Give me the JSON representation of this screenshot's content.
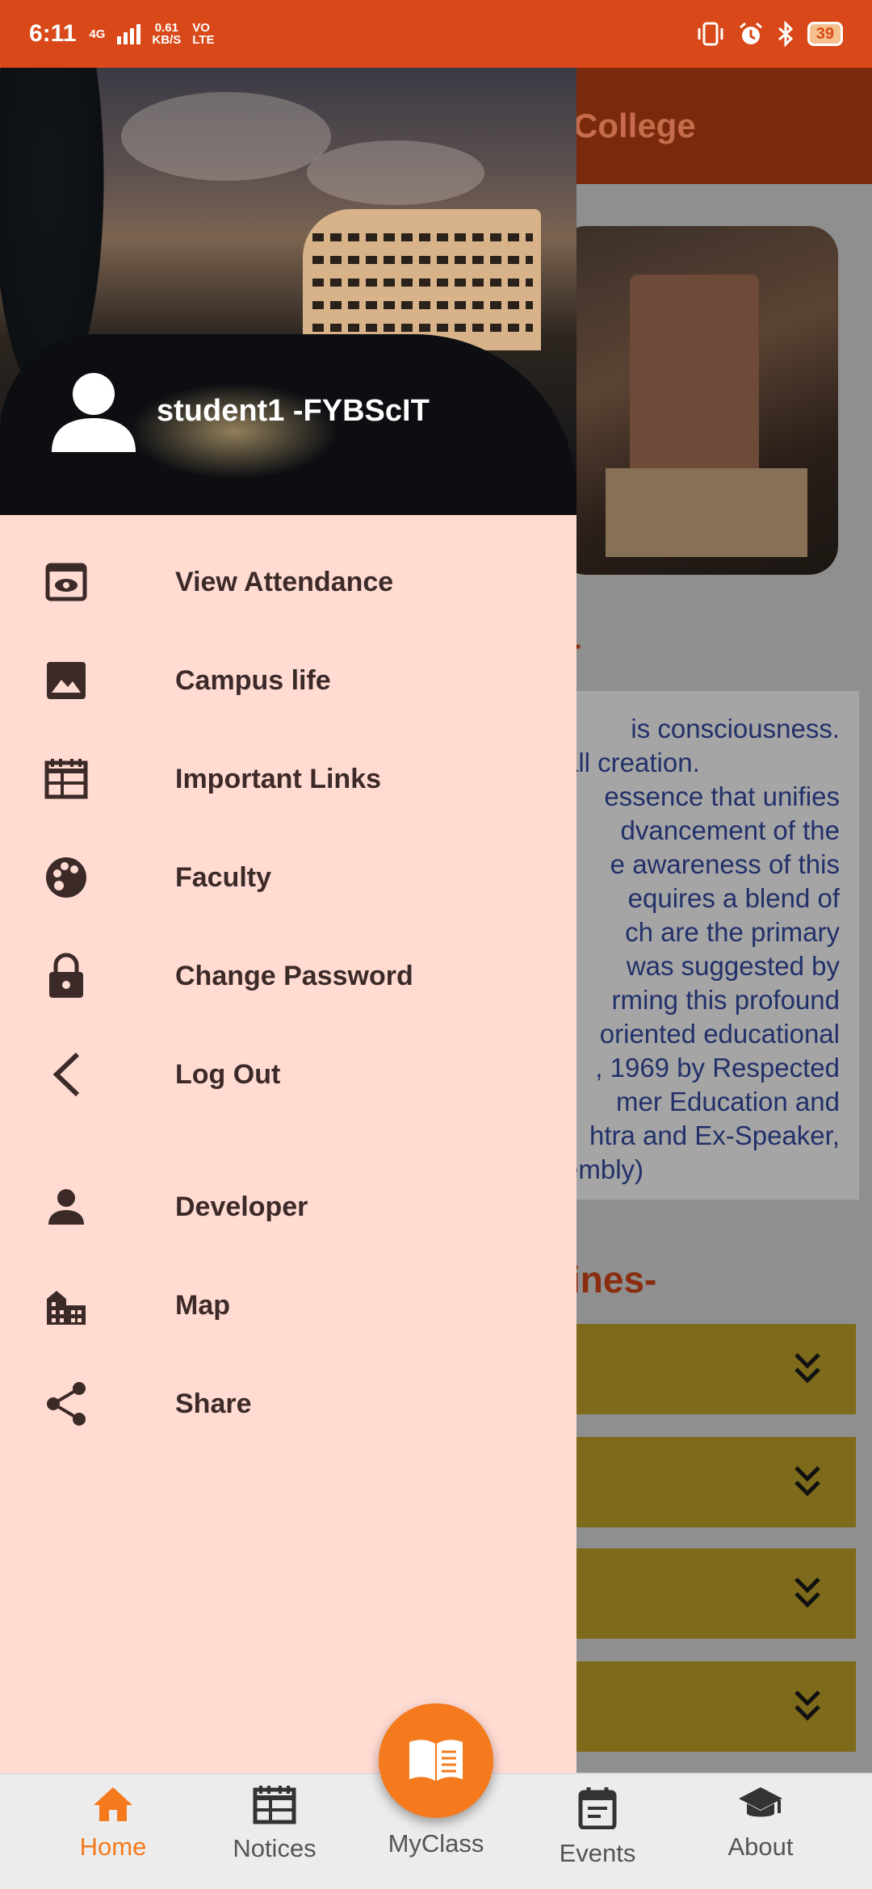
{
  "status_bar": {
    "time": "6:11",
    "network_speed": "0.61",
    "network_unit": "KB/S",
    "network_type": "4G",
    "volte": "VO LTE",
    "battery": "39"
  },
  "background_app": {
    "title_fragment": "College",
    "heading_fragment_1": "-",
    "text_lines": [
      "is consciousness.",
      "all creation.",
      "essence that unifies",
      "dvancement of the",
      "e awareness of this",
      "equires a blend of",
      "ch are the primary",
      "was suggested by",
      "rming this profound",
      "oriented educational",
      ", 1969 by Respected",
      "mer Education and",
      "htra and Ex-Speaker,",
      "embly)"
    ],
    "heading_fragment_2": "ines-"
  },
  "drawer": {
    "user": "student1 -FYBScIT",
    "menu": [
      {
        "label": "View Attendance",
        "icon": "eye-card-icon"
      },
      {
        "label": "Campus life",
        "icon": "image-icon"
      },
      {
        "label": "Important Links",
        "icon": "calendar-grid-icon"
      },
      {
        "label": "Faculty",
        "icon": "palette-icon"
      },
      {
        "label": "Change Password",
        "icon": "lock-icon"
      },
      {
        "label": "Log Out",
        "icon": "chevron-left-icon"
      },
      {
        "label": "Developer",
        "icon": "person-icon"
      },
      {
        "label": "Map",
        "icon": "city-icon"
      },
      {
        "label": "Share",
        "icon": "share-icon"
      }
    ]
  },
  "bottom_nav": {
    "items": [
      {
        "label": "Home",
        "icon": "home-icon",
        "active": true
      },
      {
        "label": "Notices",
        "icon": "newspaper-icon",
        "active": false
      },
      {
        "label": "MyClass",
        "icon": "book-icon",
        "active": false
      },
      {
        "label": "Events",
        "icon": "event-icon",
        "active": false
      },
      {
        "label": "About",
        "icon": "school-icon",
        "active": false
      }
    ]
  },
  "colors": {
    "status_bar": "#d94818",
    "drawer_bg": "#ffdbd2",
    "accent": "#f57a1e",
    "menu_text": "#3c2a28"
  }
}
